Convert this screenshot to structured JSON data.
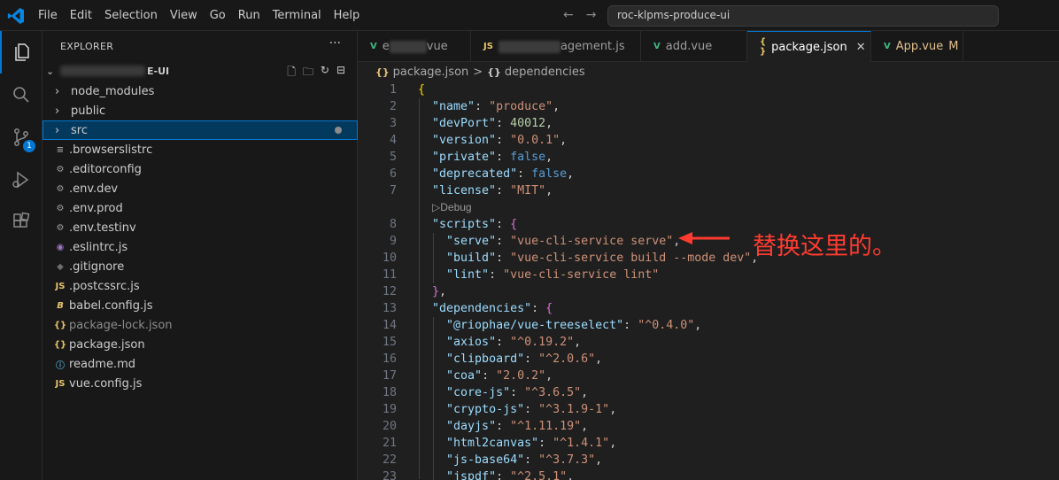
{
  "menu": [
    "File",
    "Edit",
    "Selection",
    "View",
    "Go",
    "Run",
    "Terminal",
    "Help"
  ],
  "command_center": "roc-klpms-produce-ui",
  "activity": {
    "source_control_badge": "1"
  },
  "sidebar": {
    "title": "EXPLORER",
    "more": "···",
    "project_suffix": "E-UI",
    "items": [
      {
        "label": "node_modules",
        "chevron": "›",
        "icon": ""
      },
      {
        "label": "public",
        "chevron": "›",
        "icon": ""
      },
      {
        "label": "src",
        "chevron": "›",
        "icon": ""
      },
      {
        "label": ".browserslistrc",
        "icon": "≡"
      },
      {
        "label": ".editorconfig",
        "icon": "⚙"
      },
      {
        "label": ".env.dev",
        "icon": "⚙"
      },
      {
        "label": ".env.prod",
        "icon": "⚙"
      },
      {
        "label": ".env.testinv",
        "icon": "⚙"
      },
      {
        "label": ".eslintrc.js",
        "icon": "◉"
      },
      {
        "label": ".gitignore",
        "icon": "◆"
      },
      {
        "label": ".postcssrc.js",
        "icon": "JS"
      },
      {
        "label": "babel.config.js",
        "icon": "B"
      },
      {
        "label": "package-lock.json",
        "icon": "{}"
      },
      {
        "label": "package.json",
        "icon": "{}"
      },
      {
        "label": "readme.md",
        "icon": "ⓘ"
      },
      {
        "label": "vue.config.js",
        "icon": "JS"
      }
    ]
  },
  "tabs": [
    {
      "prefix": "e",
      "suffix": "vue",
      "icon": "V"
    },
    {
      "prefix": "",
      "suffix": "agement.js",
      "icon": "JS"
    },
    {
      "prefix": "add.vue",
      "suffix": "",
      "icon": "V"
    },
    {
      "prefix": "package.json",
      "suffix": "",
      "icon": "{ }",
      "close": "✕"
    },
    {
      "prefix": "App.vue",
      "suffix": "",
      "icon": "V",
      "modified": "M"
    }
  ],
  "breadcrumb": {
    "file": "package.json",
    "separator": ">",
    "path": "dependencies"
  },
  "codelens": "Debug",
  "annotation": {
    "text": "替换这里的。",
    "color": "#ff3b30"
  },
  "code": {
    "line_numbers": [
      "1",
      "2",
      "3",
      "4",
      "5",
      "6",
      "7",
      "8",
      "9",
      "10",
      "11",
      "12",
      "13",
      "14",
      "15",
      "16",
      "17",
      "18",
      "19",
      "20",
      "21",
      "22",
      "23"
    ],
    "lines": [
      "{",
      "  \"name\": \"produce\",",
      "  \"devPort\": 40012,",
      "  \"version\": \"0.0.1\",",
      "  \"private\": false,",
      "  \"deprecated\": false,",
      "  \"license\": \"MIT\",",
      "  \"scripts\": {",
      "    \"serve\": \"vue-cli-service serve\",",
      "    \"build\": \"vue-cli-service build --mode dev\",",
      "    \"lint\": \"vue-cli-service lint\"",
      "  },",
      "  \"dependencies\": {",
      "    \"@riophae/vue-treeselect\": \"^0.4.0\",",
      "    \"axios\": \"^0.19.2\",",
      "    \"clipboard\": \"^2.0.6\",",
      "    \"coa\": \"2.0.2\",",
      "    \"core-js\": \"^3.6.5\",",
      "    \"crypto-js\": \"^3.1.9-1\",",
      "    \"dayjs\": \"^1.11.19\",",
      "    \"html2canvas\": \"^1.4.1\",",
      "    \"js-base64\": \"^3.7.3\",",
      "    \"jspdf\": \"^2.5.1\","
    ]
  }
}
